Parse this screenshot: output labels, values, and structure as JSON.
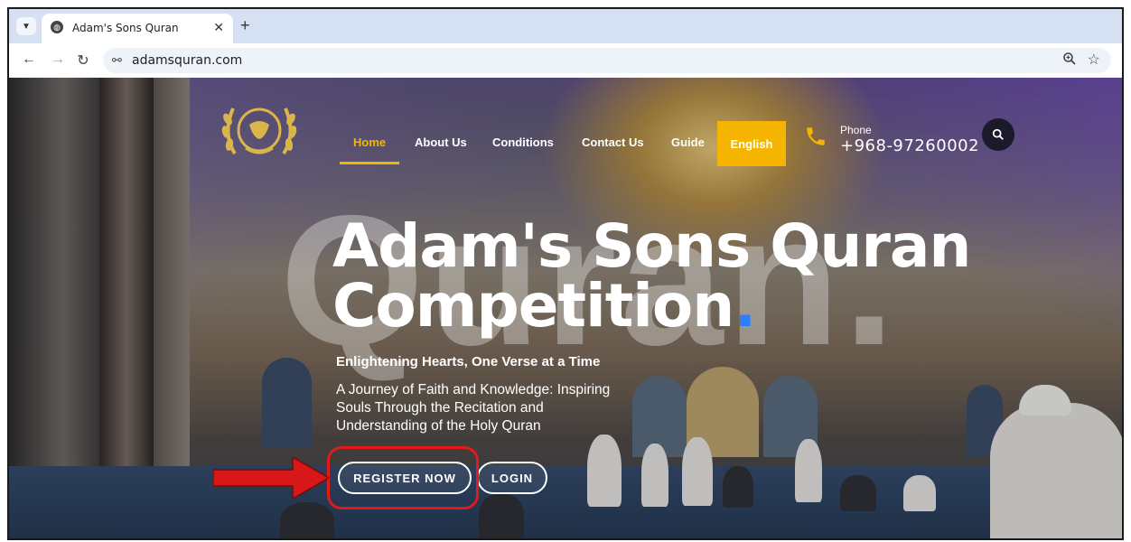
{
  "browser": {
    "tab_title": "Adam's Sons Quran",
    "url": "adamsquran.com"
  },
  "nav": {
    "items": [
      "Home",
      "About Us",
      "Conditions",
      "Contact Us",
      "Guide"
    ],
    "active": "Home",
    "language": "English",
    "phone_label": "Phone",
    "phone_number": "+968-97260002"
  },
  "hero": {
    "watermark": "Quran.",
    "title_line1": "Adam's Sons Quran",
    "title_line2": "Competition",
    "title_dot": ".",
    "tagline": "Enlightening Hearts, One Verse at a Time",
    "description": "A Journey of Faith and Knowledge: Inspiring Souls Through the Recitation and Understanding of the Holy Quran",
    "register_label": "REGISTER NOW",
    "login_label": "LOGIN"
  },
  "colors": {
    "accent": "#f2b705",
    "language_button": "#f5b400",
    "title_dot": "#2a7fff",
    "annotation": "#e01b1b"
  },
  "icons": {
    "tab_favicon": "globe-icon",
    "nav_back": "arrow-left-icon",
    "nav_forward": "arrow-right-icon",
    "reload": "reload-icon",
    "site_info": "site-settings-icon",
    "zoom": "zoom-icon",
    "bookmark": "star-icon",
    "phone": "phone-icon",
    "search": "search-icon"
  }
}
